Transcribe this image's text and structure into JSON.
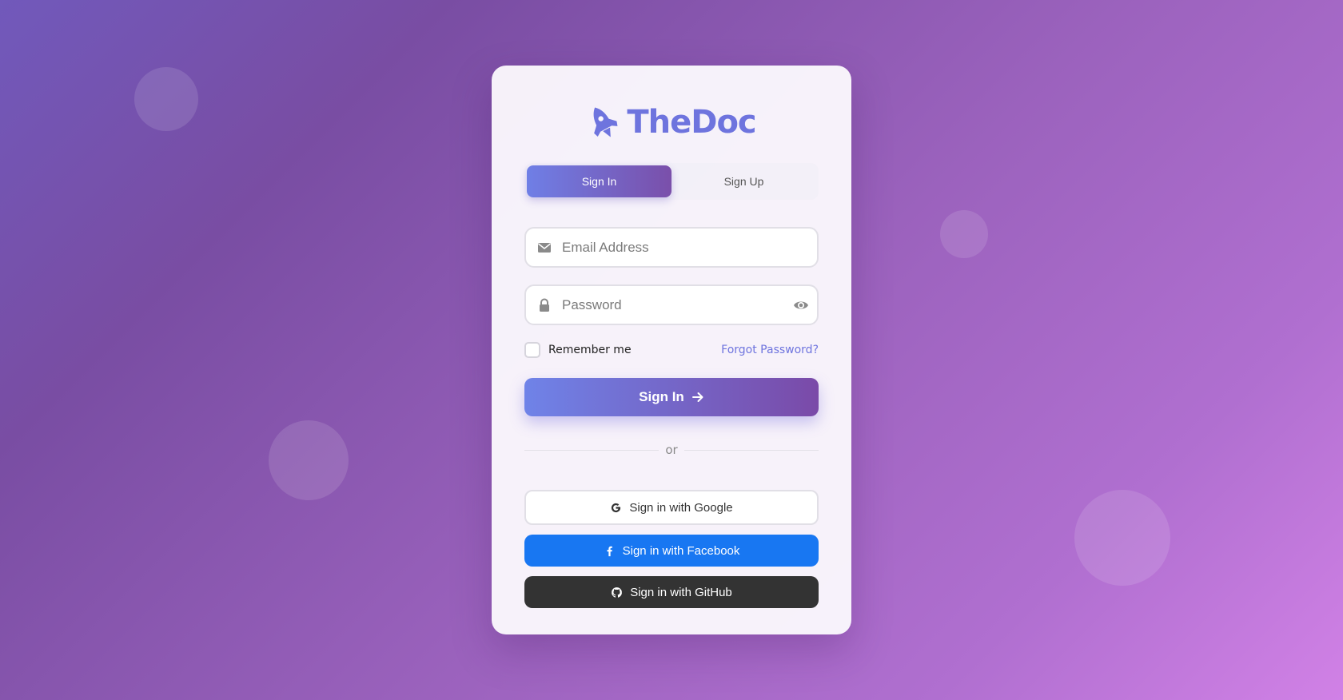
{
  "brand": {
    "name": "TheDoc",
    "logo_icon": "rocket-icon",
    "color": "#6e74de"
  },
  "tabs": [
    {
      "label": "Sign In",
      "active": true
    },
    {
      "label": "Sign Up",
      "active": false
    }
  ],
  "form": {
    "email": {
      "placeholder": "Email Address",
      "value": "",
      "icon": "envelope-icon"
    },
    "password": {
      "placeholder": "Password",
      "value": "",
      "icon": "lock-icon",
      "toggle_icon": "eye-icon"
    },
    "remember_label": "Remember me",
    "remember_checked": false,
    "forgot_label": "Forgot Password?",
    "submit_label": "Sign In",
    "submit_icon": "arrow-right-icon"
  },
  "divider_label": "or",
  "social": {
    "google": {
      "label": "Sign in with Google",
      "icon": "google-icon"
    },
    "facebook": {
      "label": "Sign in with Facebook",
      "icon": "facebook-icon",
      "color": "#1877f2"
    },
    "github": {
      "label": "Sign in with GitHub",
      "icon": "github-icon",
      "color": "#333333"
    }
  }
}
